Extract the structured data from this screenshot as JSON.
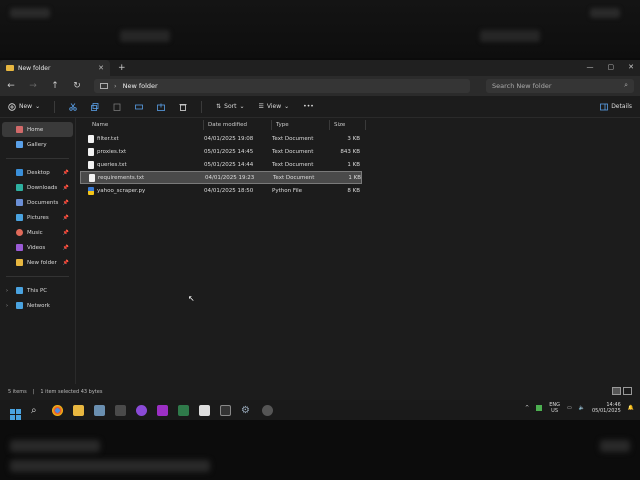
{
  "window": {
    "tab_title": "New folder",
    "new_tab_label": "+",
    "tab_close": "✕",
    "controls": {
      "minimize": "—",
      "maximize": "▢",
      "close": "✕"
    }
  },
  "address": {
    "back": "←",
    "forward": "→",
    "up": "↑",
    "refresh": "↻",
    "path_chevron": "›",
    "path": "New folder",
    "search_placeholder": "Search New folder"
  },
  "toolbar": {
    "new_label": "New",
    "sort_label": "Sort",
    "view_label": "View",
    "more_label": "•••",
    "details_label": "Details"
  },
  "nav": {
    "items": [
      {
        "label": "Home",
        "icon": "home-icon",
        "color": "#d26a6a"
      },
      {
        "label": "Gallery",
        "icon": "gallery-icon",
        "color": "#5aa0e8"
      },
      {
        "label": "Desktop",
        "icon": "desktop-icon",
        "color": "#3a8fd9",
        "pin": "📌"
      },
      {
        "label": "Downloads",
        "icon": "downloads-icon",
        "color": "#2eb0a0",
        "pin": "📌"
      },
      {
        "label": "Documents",
        "icon": "documents-icon",
        "color": "#6b8fd6",
        "pin": "📌"
      },
      {
        "label": "Pictures",
        "icon": "pictures-icon",
        "color": "#4aa3e0",
        "pin": "📌"
      },
      {
        "label": "Music",
        "icon": "music-icon",
        "color": "#e06a5a",
        "pin": "📌"
      },
      {
        "label": "Videos",
        "icon": "videos-icon",
        "color": "#9b5bd6",
        "pin": "📌"
      },
      {
        "label": "New folder",
        "icon": "folder-icon",
        "color": "#e8b740",
        "pin": "📌"
      },
      {
        "label": "This PC",
        "icon": "pc-icon",
        "color": "#4aa3e0",
        "expander": "›"
      },
      {
        "label": "Network",
        "icon": "network-icon",
        "color": "#4aa3e0",
        "expander": "›"
      }
    ]
  },
  "columns": {
    "name": "Name",
    "date": "Date modified",
    "type": "Type",
    "size": "Size"
  },
  "files": [
    {
      "name": "filter.txt",
      "date": "04/01/2025 19:08",
      "type": "Text Document",
      "size": "3 KB"
    },
    {
      "name": "proxies.txt",
      "date": "05/01/2025 14:45",
      "type": "Text Document",
      "size": "843 KB"
    },
    {
      "name": "queries.txt",
      "date": "05/01/2025 14:44",
      "type": "Text Document",
      "size": "1 KB"
    },
    {
      "name": "requirements.txt",
      "date": "04/01/2025 19:23",
      "type": "Text Document",
      "size": "1 KB"
    },
    {
      "name": "yahoo_scraper.py",
      "date": "04/01/2025 18:50",
      "type": "Python File",
      "size": "8 KB"
    }
  ],
  "status": {
    "count": "5 items",
    "divider": "|",
    "selected": "1 item selected 43 bytes"
  },
  "tray": {
    "chevron": "^",
    "lang_top": "ENG",
    "lang_bottom": "US",
    "time": "14:46",
    "date": "05/01/2025"
  },
  "colors": {
    "accent": "#4a8fe0",
    "folder": "#e8b740",
    "selection": "#4a4a4a"
  }
}
